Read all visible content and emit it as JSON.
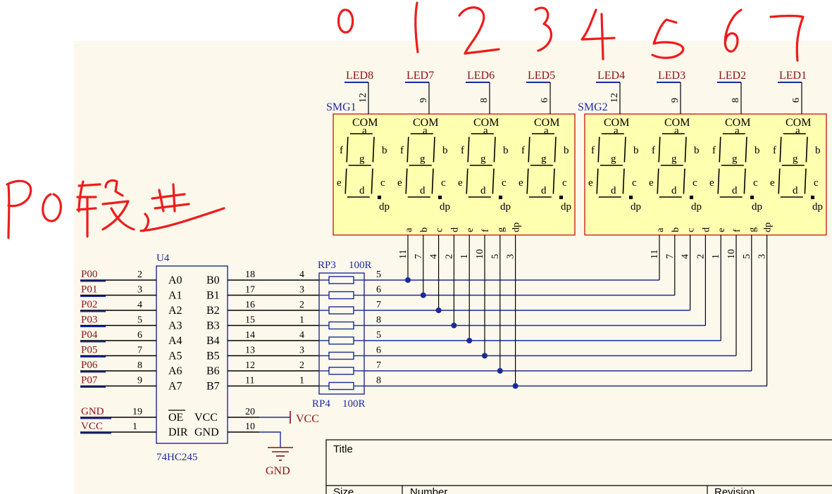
{
  "annotations": {
    "digit_labels": [
      "0",
      "1",
      "2",
      "3",
      "4",
      "5",
      "6",
      "7"
    ],
    "segment_select_note": "P0段选"
  },
  "chip_u4": {
    "designator": "U4",
    "part": "74HC245",
    "left_pins": [
      {
        "net": "P00",
        "num": "2",
        "name": "A0"
      },
      {
        "net": "P01",
        "num": "3",
        "name": "A1"
      },
      {
        "net": "P02",
        "num": "4",
        "name": "A2"
      },
      {
        "net": "P03",
        "num": "5",
        "name": "A3"
      },
      {
        "net": "P04",
        "num": "6",
        "name": "A4"
      },
      {
        "net": "P05",
        "num": "7",
        "name": "A5"
      },
      {
        "net": "P06",
        "num": "8",
        "name": "A6"
      },
      {
        "net": "P07",
        "num": "9",
        "name": "A7"
      }
    ],
    "right_pins": [
      {
        "num": "18",
        "name": "B0"
      },
      {
        "num": "17",
        "name": "B1"
      },
      {
        "num": "16",
        "name": "B2"
      },
      {
        "num": "15",
        "name": "B3"
      },
      {
        "num": "14",
        "name": "B4"
      },
      {
        "num": "13",
        "name": "B5"
      },
      {
        "num": "12",
        "name": "B6"
      },
      {
        "num": "11",
        "name": "B7"
      }
    ],
    "ctrl_left": [
      {
        "net": "GND",
        "num": "19",
        "name": "OE"
      },
      {
        "net": "VCC",
        "num": "1",
        "name": "DIR"
      }
    ],
    "ctrl_right": [
      {
        "num": "20",
        "name": "VCC"
      },
      {
        "num": "10",
        "name": "GND"
      }
    ],
    "power_vcc": "VCC",
    "power_gnd": "GND"
  },
  "resistor_packs": {
    "rp3": {
      "name": "RP3",
      "value": "100R",
      "left": [
        "4",
        "3",
        "2",
        "1"
      ],
      "right": [
        "5",
        "6",
        "7",
        "8"
      ]
    },
    "rp4": {
      "name": "RP4",
      "value": "100R",
      "left": [
        "4",
        "3",
        "2",
        "1"
      ],
      "right": [
        "5",
        "6",
        "7",
        "8"
      ]
    }
  },
  "displays": [
    {
      "name": "SMG1",
      "com_nets": [
        "LED8",
        "LED7",
        "LED6",
        "LED5"
      ],
      "com_pins": [
        "12",
        "9",
        "8",
        "6"
      ]
    },
    {
      "name": "SMG2",
      "com_nets": [
        "LED4",
        "LED3",
        "LED2",
        "LED1"
      ],
      "com_pins": [
        "12",
        "9",
        "8",
        "6"
      ]
    }
  ],
  "display_common": {
    "com_label": "COM",
    "segment_labels": {
      "a": "a",
      "b": "b",
      "c": "c",
      "d": "d",
      "e": "e",
      "f": "f",
      "g": "g",
      "dp": "dp"
    },
    "bottom_pin_names": [
      "a",
      "b",
      "c",
      "d",
      "e",
      "f",
      "g",
      "dp"
    ],
    "bottom_pin_nums": [
      "11",
      "7",
      "4",
      "2",
      "1",
      "10",
      "5",
      "3"
    ]
  },
  "title_block": {
    "title_label": "Title",
    "size_label": "Size",
    "number_label": "Number",
    "revision_label": "Revision"
  },
  "colors": {
    "sheet": "#fdf8ec",
    "display_fill": "#ffffb0",
    "display_border": "#c00000",
    "wire": "#1a2a9a",
    "net_label": "#8a1010",
    "annotation": "#ee1c1c"
  }
}
